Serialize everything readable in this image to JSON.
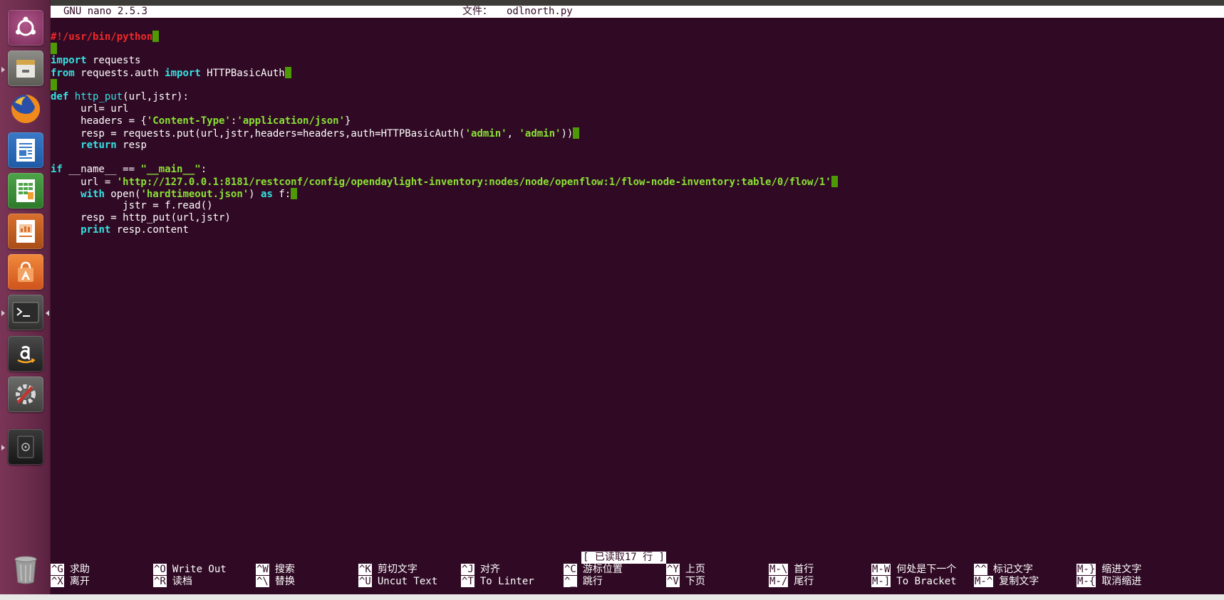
{
  "nano": {
    "version": "GNU nano 2.5.3",
    "file_label": "文件：",
    "file_name": "odlnorth.py",
    "status_message": "[ 已读取17 行 ]"
  },
  "code": {
    "l1": "#!/usr/bin/python",
    "l3a": "import",
    "l3b": " requests",
    "l4a": "from",
    "l4b": " requests.auth ",
    "l4c": "import",
    "l4d": " HTTPBasicAuth",
    "l6a": "def",
    "l6b": " ",
    "l6c": "http_put",
    "l6d": "(url,jstr):",
    "l7": "     url= url",
    "l8a": "     headers = {",
    "l8b": "'Content-Type'",
    "l8c": ":",
    "l8d": "'application/json'",
    "l8e": "}",
    "l9a": "     resp = requests.put(url,jstr,headers=headers,auth=HTTPBasicAuth(",
    "l9b": "'admin'",
    "l9c": ", ",
    "l9d": "'admin'",
    "l9e": "))",
    "l10a": "     ",
    "l10b": "return",
    "l10c": " resp",
    "l12a": "if",
    "l12b": " __name__ == ",
    "l12c": "\"__main__\"",
    "l12d": ":",
    "l13a": "     url = ",
    "l13b": "'http://127.0.0.1:8181/restconf/config/opendaylight-inventory:nodes/node/openflow:1/flow-node-inventory:table/0/flow/1'",
    "l14a": "     ",
    "l14b": "with",
    "l14c": " open(",
    "l14d": "'hardtimeout.json'",
    "l14e": ") ",
    "l14f": "as",
    "l14g": " f:",
    "l15": "            jstr = f.read()",
    "l16": "     resp = http_put(url,jstr)",
    "l17a": "     ",
    "l17b": "print",
    "l17c": " resp.content"
  },
  "shortcuts": [
    {
      "key": "^G",
      "label": "求助"
    },
    {
      "key": "^X",
      "label": "离开"
    },
    {
      "key": "^O",
      "label": "Write Out"
    },
    {
      "key": "^R",
      "label": "读档"
    },
    {
      "key": "^W",
      "label": "搜索"
    },
    {
      "key": "^\\",
      "label": "替换"
    },
    {
      "key": "^K",
      "label": "剪切文字"
    },
    {
      "key": "^U",
      "label": "Uncut Text"
    },
    {
      "key": "^J",
      "label": "对齐"
    },
    {
      "key": "^T",
      "label": "To Linter"
    },
    {
      "key": "^C",
      "label": "游标位置"
    },
    {
      "key": "^_",
      "label": "跳行"
    },
    {
      "key": "^Y",
      "label": "上页"
    },
    {
      "key": "^V",
      "label": "下页"
    },
    {
      "key": "M-\\",
      "label": "首行"
    },
    {
      "key": "M-/",
      "label": "尾行"
    },
    {
      "key": "M-W",
      "label": "何处是下一个"
    },
    {
      "key": "M-]",
      "label": "To Bracket"
    },
    {
      "key": "^^",
      "label": "标记文字"
    },
    {
      "key": "M-^",
      "label": "复制文字"
    },
    {
      "key": "M-}",
      "label": "缩进文字"
    },
    {
      "key": "M-{",
      "label": "取消缩进"
    }
  ],
  "colors": {
    "terminal_bg": "#300a24",
    "keyword": "#34e2e2",
    "string": "#8ae234",
    "shebang": "#ef2929",
    "cursor": "#4e9a06"
  }
}
